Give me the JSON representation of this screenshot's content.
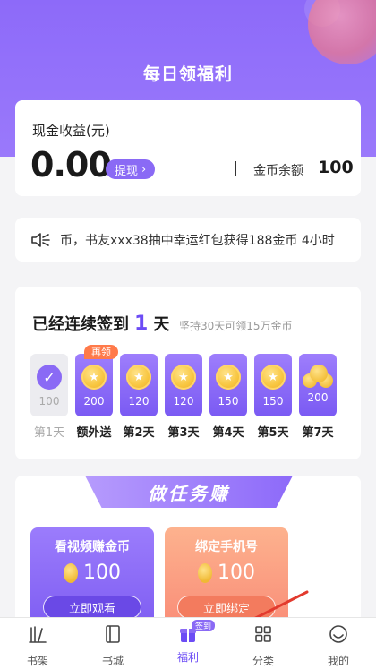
{
  "header": {
    "title": "每日领福利"
  },
  "earnings": {
    "label": "现金收益(元)",
    "value": "0.00",
    "withdraw_label": "提现",
    "coin_label": "金币余额",
    "coin_value": "100"
  },
  "notice": {
    "text": "币，书友xxx38抽中幸运红包获得188金币   4小时"
  },
  "signin": {
    "prefix": "已经连续签到",
    "days": "1",
    "suffix": "天",
    "subtitle": "坚持30天可领15万金币",
    "items": [
      {
        "amount": "100",
        "label": "第1天"
      },
      {
        "amount": "200",
        "label": "额外送",
        "tag": "再领"
      },
      {
        "amount": "120",
        "label": "第2天"
      },
      {
        "amount": "120",
        "label": "第3天"
      },
      {
        "amount": "150",
        "label": "第4天"
      },
      {
        "amount": "150",
        "label": "第5天"
      },
      {
        "amount": "200",
        "label": "第7天"
      }
    ]
  },
  "tasks": {
    "banner": "做任务赚",
    "items": [
      {
        "name": "看视频赚金币",
        "reward": "100",
        "button": "立即观看"
      },
      {
        "name": "绑定手机号",
        "reward": "100",
        "button": "立即绑定"
      }
    ]
  },
  "tabbar": {
    "items": [
      {
        "label": "书架"
      },
      {
        "label": "书城"
      },
      {
        "label": "福利",
        "badge": "签到"
      },
      {
        "label": "分类"
      },
      {
        "label": "我的"
      }
    ]
  },
  "colors": {
    "accent": "#8a6af5",
    "orange": "#f98d78"
  }
}
